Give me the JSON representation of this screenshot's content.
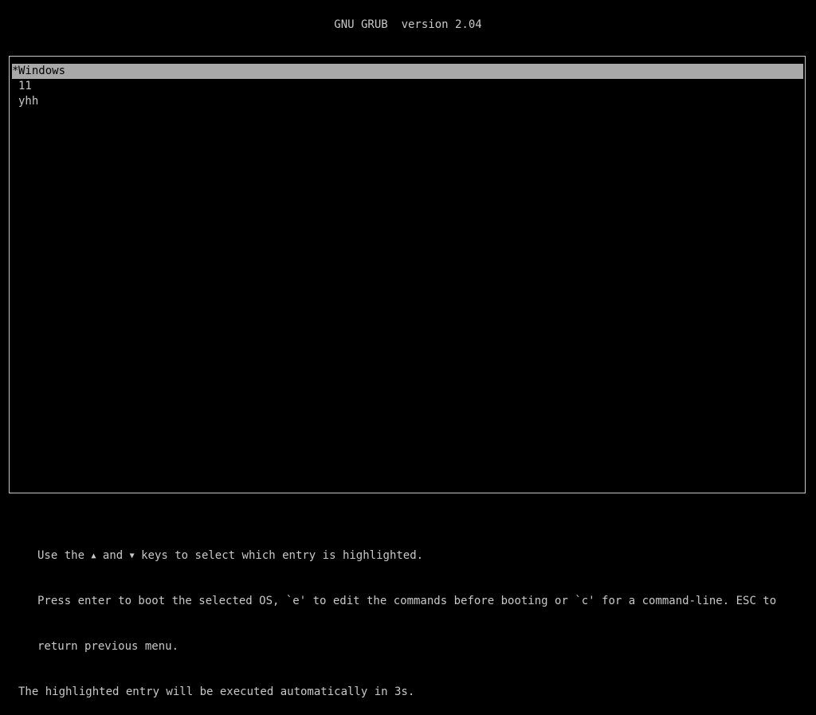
{
  "header": {
    "title": "GNU GRUB  version 2.04"
  },
  "menu": {
    "selected_marker": "*",
    "entries": [
      {
        "label": "Windows",
        "selected": true
      },
      {
        "label": "11",
        "selected": false
      },
      {
        "label": "yhh",
        "selected": false
      }
    ]
  },
  "help": {
    "line1_a": "Use the ",
    "up_arrow": "▲",
    "line1_b": " and ",
    "down_arrow": "▼",
    "line1_c": " keys to select which entry is highlighted.",
    "line2": "Press enter to boot the selected OS, `e' to edit the commands before booting or `c' for a command-line. ESC to",
    "line3": "return previous menu.",
    "countdown": "The highlighted entry will be executed automatically in 3s."
  },
  "colors": {
    "background": "#000000",
    "text": "#c8c8c8",
    "highlight_bg": "#a8a8a8",
    "highlight_text": "#000000"
  }
}
